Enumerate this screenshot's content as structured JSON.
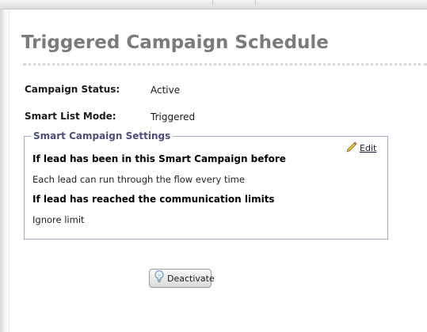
{
  "page": {
    "title": "Triggered Campaign Schedule"
  },
  "fields": {
    "status_label": "Campaign Status:",
    "status_value": "Active",
    "mode_label": "Smart List Mode:",
    "mode_value": "Triggered"
  },
  "settings": {
    "legend": "Smart Campaign Settings",
    "edit_label": "Edit",
    "edit_icon": "pencil-icon",
    "rules": [
      {
        "heading": "If lead has been in this Smart Campaign before",
        "value": "Each lead can run through the flow every time"
      },
      {
        "heading": "If lead has reached the communication limits",
        "value": "Ignore limit"
      }
    ]
  },
  "actions": {
    "deactivate_label": "Deactivate",
    "deactivate_icon": "lightbulb-icon"
  },
  "colors": {
    "title": "#7b7b7b",
    "legend": "#4a4f7a",
    "box_border": "#a9a9c4"
  }
}
